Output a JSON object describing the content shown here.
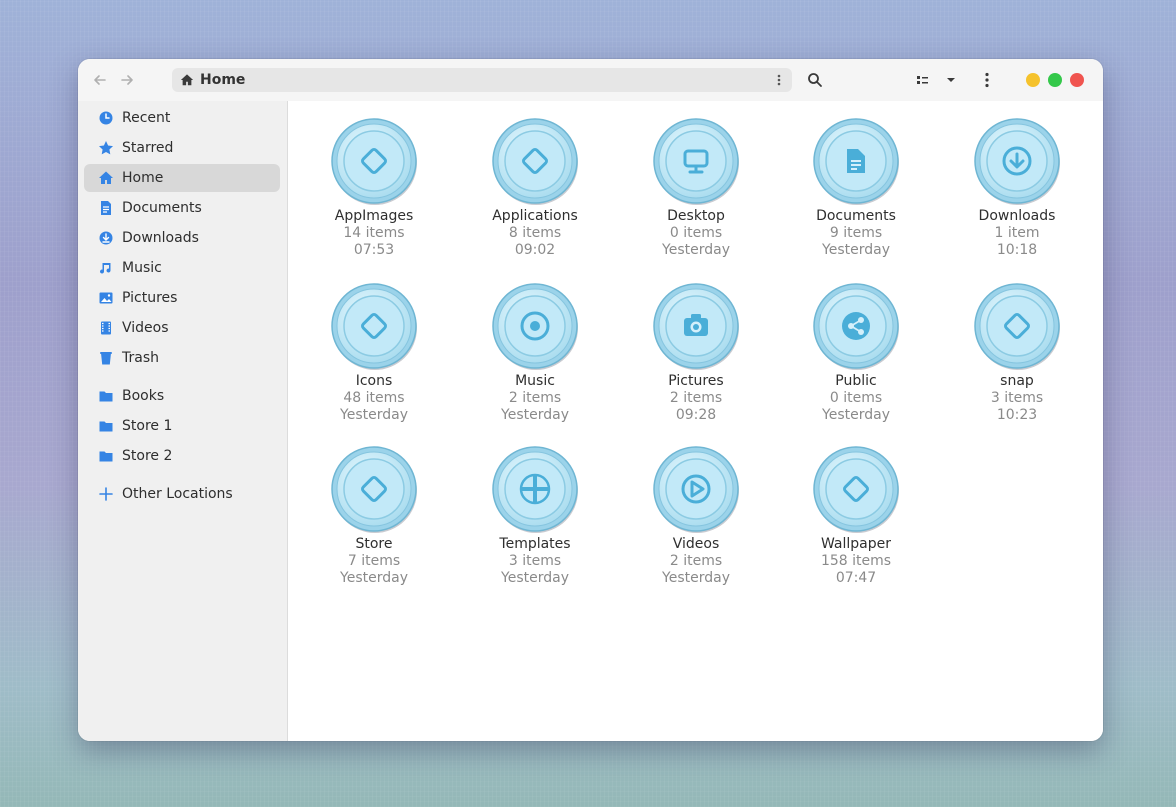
{
  "headerbar": {
    "path_label": "Home",
    "back_icon": "arrow-left-icon",
    "forward_icon": "arrow-right-icon",
    "search_icon": "search-icon",
    "view_icon": "list-view-icon",
    "menu_icon": "kebab-menu-icon",
    "colors": {
      "minimize": "#f5c22c",
      "maximize": "#34c84a",
      "close": "#f0544f"
    }
  },
  "sidebar": {
    "items": [
      {
        "label": "Recent",
        "icon": "clock-icon"
      },
      {
        "label": "Starred",
        "icon": "star-icon"
      },
      {
        "label": "Home",
        "icon": "home-icon",
        "active": true
      },
      {
        "label": "Documents",
        "icon": "document-icon"
      },
      {
        "label": "Downloads",
        "icon": "download-icon"
      },
      {
        "label": "Music",
        "icon": "music-icon"
      },
      {
        "label": "Pictures",
        "icon": "picture-icon"
      },
      {
        "label": "Videos",
        "icon": "video-icon"
      },
      {
        "label": "Trash",
        "icon": "trash-icon"
      }
    ],
    "bookmarks": [
      {
        "label": "Books",
        "icon": "folder-icon"
      },
      {
        "label": "Store 1",
        "icon": "folder-icon"
      },
      {
        "label": "Store 2",
        "icon": "folder-icon"
      }
    ],
    "other": {
      "label": "Other Locations",
      "icon": "plus-icon"
    }
  },
  "files": [
    {
      "name": "AppImages",
      "count": "14 items",
      "time": "07:53",
      "icon": "diamond-icon"
    },
    {
      "name": "Applications",
      "count": "8 items",
      "time": "09:02",
      "icon": "diamond-icon"
    },
    {
      "name": "Desktop",
      "count": "0 items",
      "time": "Yesterday",
      "icon": "monitor-icon"
    },
    {
      "name": "Documents",
      "count": "9 items",
      "time": "Yesterday",
      "icon": "document-icon"
    },
    {
      "name": "Downloads",
      "count": "1 item",
      "time": "10:18",
      "icon": "download-icon"
    },
    {
      "name": "Icons",
      "count": "48 items",
      "time": "Yesterday",
      "icon": "diamond-icon"
    },
    {
      "name": "Music",
      "count": "2 items",
      "time": "Yesterday",
      "icon": "disc-icon"
    },
    {
      "name": "Pictures",
      "count": "2 items",
      "time": "09:28",
      "icon": "camera-icon"
    },
    {
      "name": "Public",
      "count": "0 items",
      "time": "Yesterday",
      "icon": "share-icon"
    },
    {
      "name": "snap",
      "count": "3 items",
      "time": "10:23",
      "icon": "diamond-icon"
    },
    {
      "name": "Store",
      "count": "7 items",
      "time": "Yesterday",
      "icon": "diamond-icon"
    },
    {
      "name": "Templates",
      "count": "3 items",
      "time": "Yesterday",
      "icon": "plus-icon"
    },
    {
      "name": "Videos",
      "count": "2 items",
      "time": "Yesterday",
      "icon": "play-icon"
    },
    {
      "name": "Wallpaper",
      "count": "158 items",
      "time": "07:47",
      "icon": "diamond-icon"
    }
  ]
}
